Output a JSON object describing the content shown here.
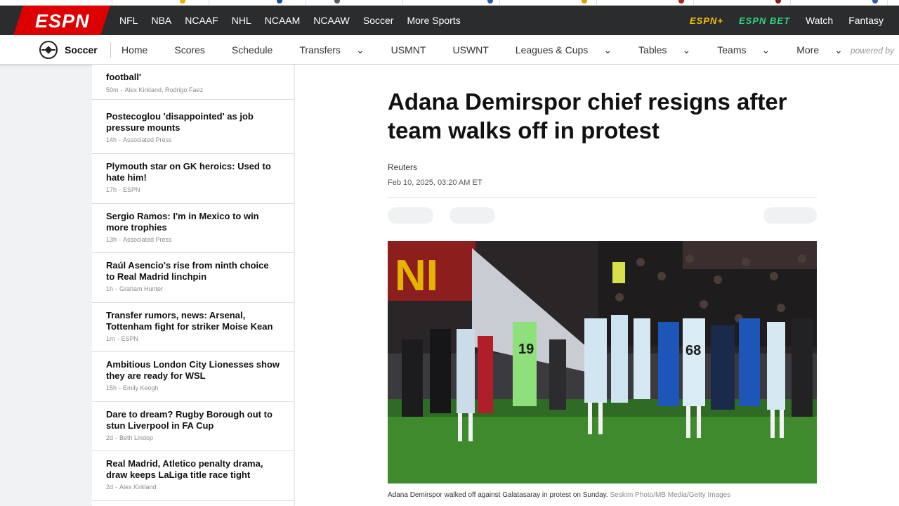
{
  "top_nav": {
    "logo": "ESPN",
    "sports": [
      "NFL",
      "NBA",
      "NCAAF",
      "NHL",
      "NCAAM",
      "NCAAW",
      "Soccer",
      "More Sports"
    ],
    "espn_plus": "ESPN+",
    "espn_bet": "ESPN BET",
    "watch": "Watch",
    "fantasy": "Fantasy"
  },
  "sub_nav": {
    "title": "Soccer",
    "links": [
      "Home",
      "Scores",
      "Schedule",
      "Transfers",
      "USMNT",
      "USWNT",
      "Leagues & Cups",
      "Tables",
      "Teams",
      "More"
    ],
    "powered_by": "powered by"
  },
  "headlines": [
    {
      "title": "football'",
      "time": "50m",
      "author": "Alex Kirkland, Rodrigo Faez"
    },
    {
      "title": "Postecoglou 'disappointed' as job pressure mounts",
      "time": "14h",
      "author": "Associated Press"
    },
    {
      "title": "Plymouth star on GK heroics: Used to hate him!",
      "time": "17h",
      "author": "ESPN"
    },
    {
      "title": "Sergio Ramos: I'm in Mexico to win more trophies",
      "time": "13h",
      "author": "Associated Press"
    },
    {
      "title": "Raúl Asencio's rise from ninth choice to Real Madrid linchpin",
      "time": "1h",
      "author": "Graham Hunter"
    },
    {
      "title": "Transfer rumors, news: Arsenal, Tottenham fight for striker Moise Kean",
      "time": "1m",
      "author": "ESPN"
    },
    {
      "title": "Ambitious London City Lionesses show they are ready for WSL",
      "time": "15h",
      "author": "Emily Keogh"
    },
    {
      "title": "Dare to dream? Rugby Borough out to stun Liverpool in FA Cup",
      "time": "2d",
      "author": "Beth Lindop"
    },
    {
      "title": "Real Madrid, Atletico penalty drama, draw keeps LaLiga title race tight",
      "time": "2d",
      "author": "Alex Kirkland"
    }
  ],
  "article": {
    "headline": "Adana Demirspor chief resigns after team walks off in protest",
    "byline": "Reuters",
    "timestamp": "Feb 10, 2025, 03:20 AM ET",
    "caption": "Adana Demirspor walked off against Galatasaray in protest on Sunday.",
    "credit": "Seskim Photo/MB Media/Getty Images"
  },
  "colors": {
    "espn_red": "#dd0000",
    "nav_dark": "#2b2c2d",
    "espn_plus_yellow": "#f5c400",
    "espn_bet_green": "#33d27d"
  }
}
